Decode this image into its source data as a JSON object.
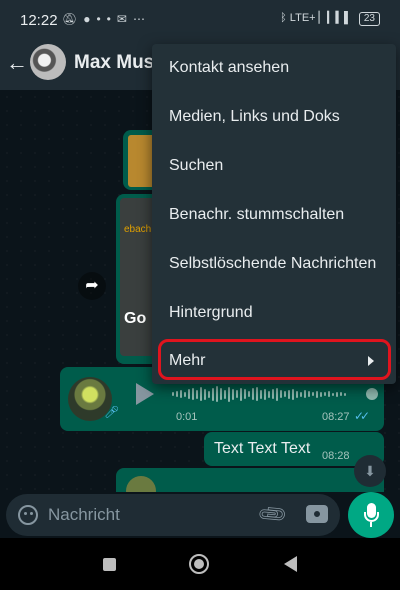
{
  "status_bar": {
    "time": "12:22",
    "network": "LTE+",
    "battery": "23",
    "left_icons": [
      "mute-bell-icon",
      "chat-bubble-icon",
      "dots-icon",
      "mail-icon",
      "more-icon"
    ]
  },
  "header": {
    "contact_name": "Max Must"
  },
  "chat": {
    "map_label": "ebach",
    "map_logo": "Go",
    "voice_message": {
      "duration": "0:01",
      "time": "08:27"
    },
    "text_message": {
      "text": "Text Text Text",
      "time": "08:28"
    }
  },
  "menu": {
    "items": [
      {
        "label": "Kontakt ansehen"
      },
      {
        "label": "Medien, Links und Doks"
      },
      {
        "label": "Suchen"
      },
      {
        "label": "Benachr. stummschalten"
      },
      {
        "label": "Selbstlöschende Nachrichten"
      },
      {
        "label": "Hintergrund"
      },
      {
        "label": "Mehr",
        "has_submenu": true,
        "highlighted": true
      }
    ]
  },
  "input": {
    "placeholder": "Nachricht"
  },
  "colors": {
    "accent": "#00a884",
    "outgoing_bubble": "#005c4b",
    "highlight_frame": "#e0141e",
    "read_ticks": "#53bdeb"
  }
}
